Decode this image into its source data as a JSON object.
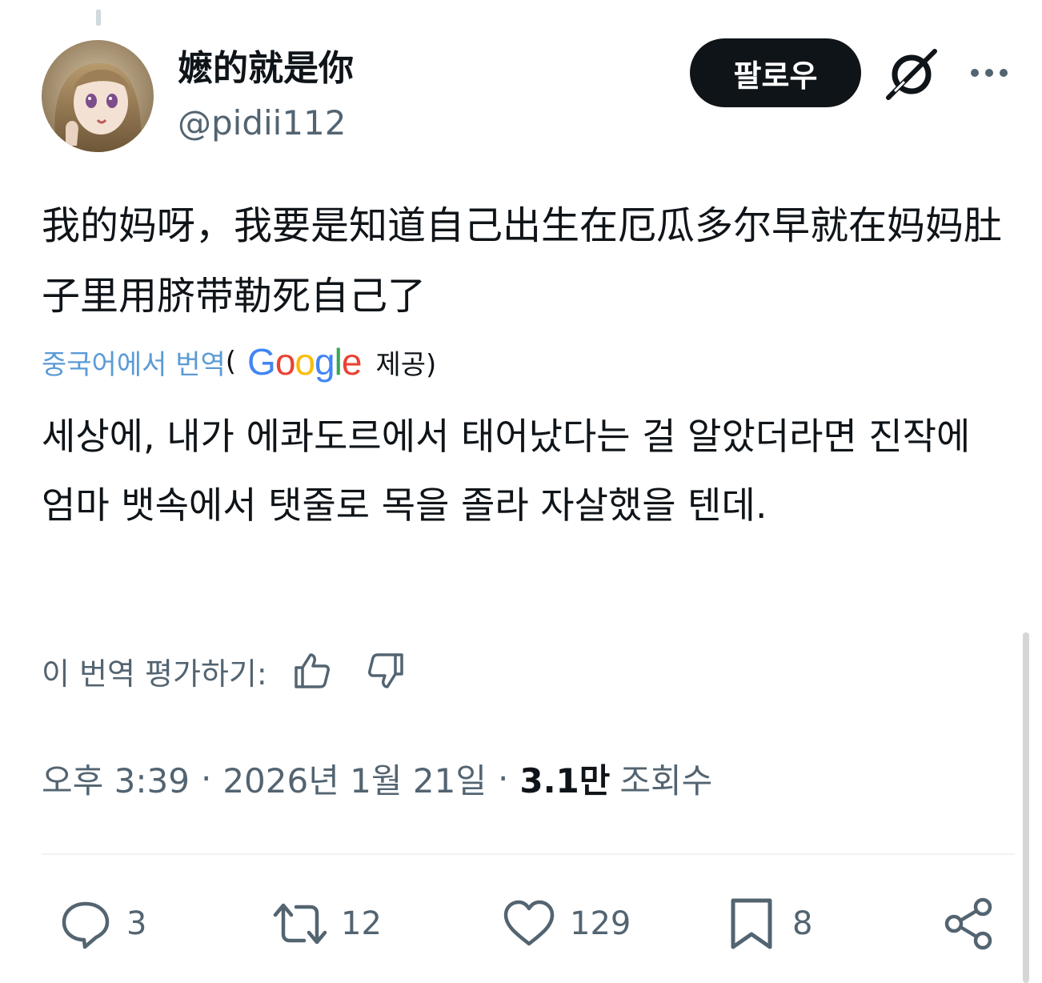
{
  "user": {
    "display_name": "嬷的就是你",
    "handle": "@pidii112"
  },
  "header": {
    "follow_label": "팔로우",
    "grok_icon": "grok-icon",
    "more_icon": "more-icon"
  },
  "post": {
    "original_text": "我的妈呀，我要是知道自己出生在厄瓜多尔早就在妈妈肚子里用脐带勒死自己了",
    "translate_link": "중국어에서 번역",
    "google_logo_text": "Google",
    "provided_by": "제공)",
    "translated_text": "세상에, 내가 에콰도르에서 태어났다는 걸 알았더라면 진작에 엄마 뱃속에서 탯줄로 목을 졸라 자살했을 텐데.",
    "rate_label": "이 번역 평가하기:"
  },
  "meta": {
    "time": "오후 3:39",
    "date": "2026년 1월 21일",
    "views_count": "3.1만",
    "views_label": "조회수"
  },
  "actions": {
    "replies": "3",
    "reposts": "12",
    "likes": "129",
    "bookmarks": "8"
  },
  "colors": {
    "text": "#0f1419",
    "secondary": "#536471",
    "translate_link": "#5b9bd5",
    "follow_bg": "#0f1419"
  }
}
